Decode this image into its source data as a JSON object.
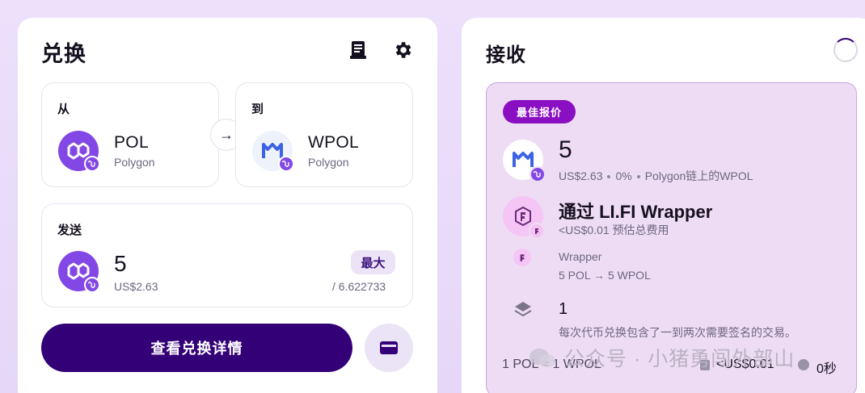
{
  "swap": {
    "title": "兑换",
    "from_label": "从",
    "to_label": "到",
    "send_label": "发送",
    "from_token": {
      "symbol": "POL",
      "chain": "Polygon"
    },
    "to_token": {
      "symbol": "WPOL",
      "chain": "Polygon"
    },
    "send": {
      "amount": "5",
      "usd": "US$2.63",
      "max_label": "最大",
      "balance": "/ 6.622733"
    },
    "arrow": "→",
    "details_button": "查看兑换详情"
  },
  "receive": {
    "title": "接收",
    "best_badge": "最佳报价",
    "amount": "5",
    "usd": "US$2.63",
    "pct": "0%",
    "token_desc": "Polygon链上的WPOL",
    "via": "通过 LI.FI Wrapper",
    "fee": "<US$0.01 预估总费用",
    "step_name": "Wrapper",
    "step_detail": "5 POL → 5 WPOL",
    "tx_count": "1",
    "tx_note": "每次代币兑换包含了一到两次需要签名的交易。",
    "rate": "1 POL ≈ 1 WPOL",
    "gas": "<US$0.01",
    "time": "0秒"
  },
  "watermark": "公众号 · 小猪勇闯外部山",
  "colors": {
    "primary": "#330078",
    "badge": "#8a0fc2",
    "polygon": "#8247e5",
    "quote_bg": "#eedcf4"
  },
  "icons": [
    "receipt-icon",
    "gear-icon",
    "arrow-right-icon",
    "wallet-icon",
    "layers-icon",
    "wechat-icon"
  ]
}
